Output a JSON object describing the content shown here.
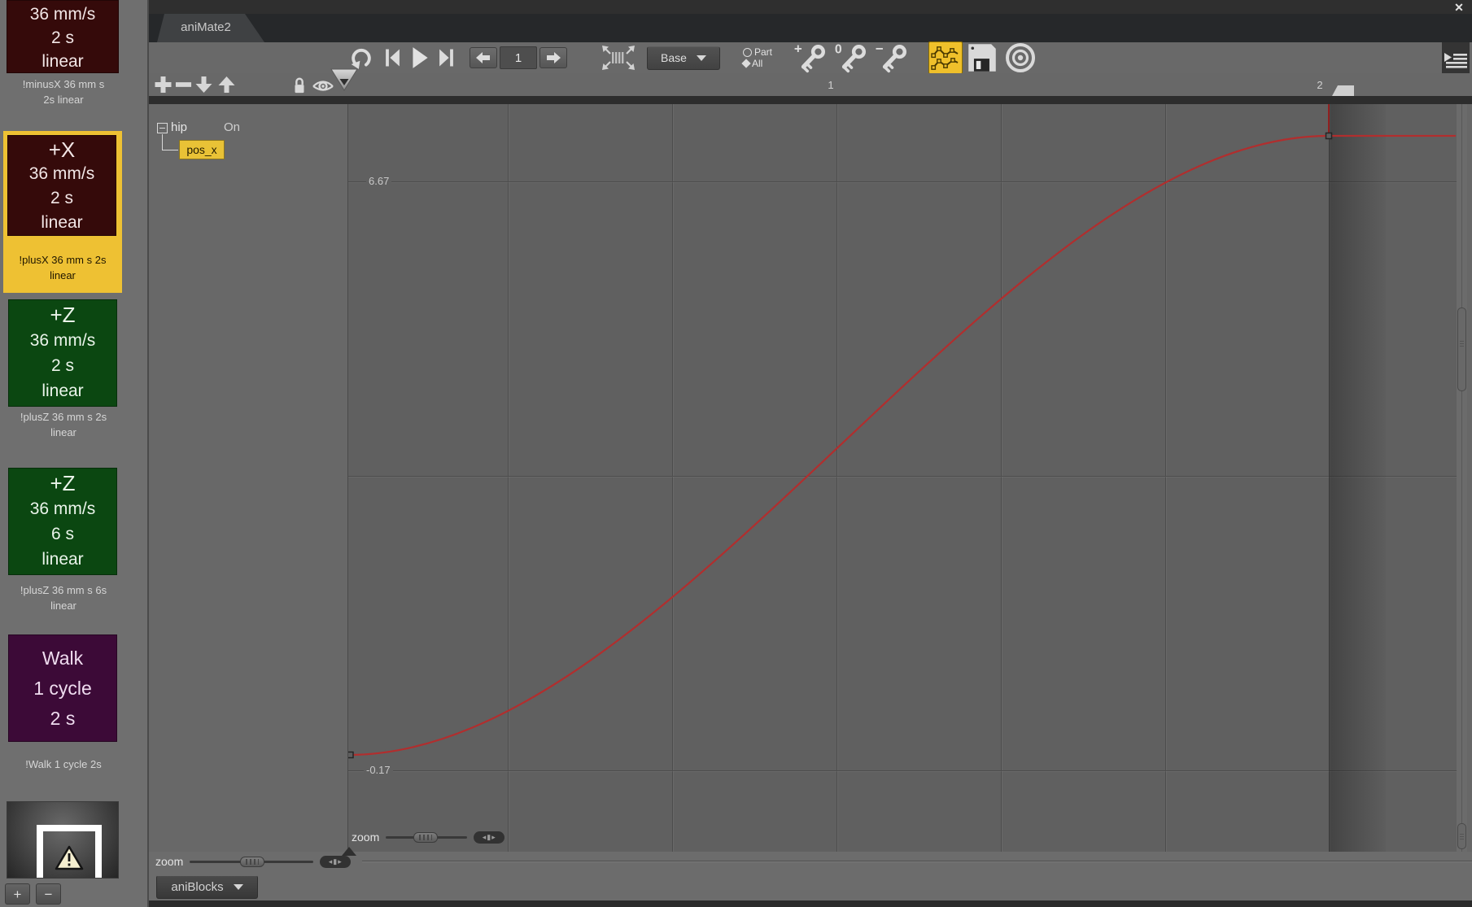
{
  "window": {
    "close_glyph": "✕"
  },
  "tab": {
    "label": "aniMate2"
  },
  "transport": {
    "frame_value": "1"
  },
  "selectors": {
    "layer": "Base",
    "part": "Part",
    "all": "All"
  },
  "ruler": {
    "tick_labels": [
      "1",
      "2"
    ]
  },
  "tree": {
    "node_label": "hip",
    "node_state": "On",
    "channel_label": "pos_x"
  },
  "graph": {
    "y_upper_label": "6.67",
    "y_lower_label": "-0.17",
    "zoom_label": "zoom",
    "v_gridlines": [
      196,
      398,
      600,
      802,
      1004,
      1205
    ],
    "h_gridlines": [
      95,
      457,
      819
    ],
    "curve": {
      "color": "#b12e2e",
      "start": [
        0,
        800
      ],
      "c1": [
        400,
        800
      ],
      "c2": [
        810,
        39
      ],
      "end": [
        1205,
        39
      ],
      "tail_x": 1361
    }
  },
  "bottombar": {
    "zoom_label": "zoom",
    "blocks_dropdown_label": "aniBlocks"
  },
  "sidebar": {
    "selected_color": "#eec133",
    "add_label": "+",
    "remove_label": "−",
    "blocks": [
      {
        "lines": [
          "36 mm/s",
          "2 s",
          "linear"
        ],
        "big_first": false,
        "bg": "#350a0a",
        "fg": "#f2e6e6",
        "caption": [
          "!minusX 36 mm s",
          "2s linear"
        ],
        "selected": false
      },
      {
        "lines": [
          "+X",
          "36 mm/s",
          "2 s",
          "linear"
        ],
        "big_first": true,
        "bg": "#350a0a",
        "fg": "#f2e6e6",
        "caption": [
          "!plusX 36 mm s 2s",
          "linear"
        ],
        "selected": true
      },
      {
        "lines": [
          "+Z",
          "36 mm/s",
          "2 s",
          "linear"
        ],
        "big_first": true,
        "bg": "#0b4711",
        "fg": "#eaf4ea",
        "caption": [
          "!plusZ 36 mm s 2s",
          "linear"
        ],
        "selected": false
      },
      {
        "lines": [
          "+Z",
          "36 mm/s",
          "6 s",
          "linear"
        ],
        "big_first": true,
        "bg": "#0b4711",
        "fg": "#eaf4ea",
        "caption": [
          "!plusZ 36 mm s 6s",
          "linear"
        ],
        "selected": false
      },
      {
        "lines": [
          "Walk",
          "1 cycle",
          "2 s"
        ],
        "big_first": false,
        "bg": "#3c0a37",
        "fg": "#efdcef",
        "caption": [
          "!Walk 1 cycle 2s"
        ],
        "selected": false
      }
    ]
  },
  "chart_data": {
    "type": "line",
    "title": "pos_x keyframe curve (aniMate2 curve editor)",
    "series": [
      {
        "name": "pos_x",
        "keyframes": [
          {
            "time_s": 0,
            "value": 0.0
          },
          {
            "time_s": 2,
            "value": 7.2
          }
        ],
        "interpolation": "ease-in-out"
      }
    ],
    "y_axis_labels_visible": [
      "6.67",
      "-0.17"
    ],
    "x_axis_ticks_visible": [
      "1",
      "2"
    ],
    "x_gridline_interval_s": 0.333,
    "curve_color": "#b12e2e",
    "legend": "none",
    "grid": true
  }
}
